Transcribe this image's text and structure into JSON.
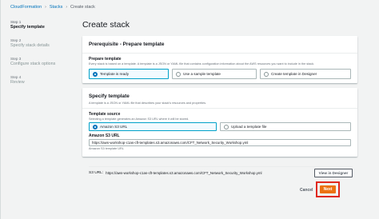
{
  "breadcrumb": {
    "items": [
      "CloudFormation",
      "Stacks",
      "Create stack"
    ]
  },
  "steps": [
    {
      "num": "Step 1",
      "title": "Specify template"
    },
    {
      "num": "Step 2",
      "title": "Specify stack details"
    },
    {
      "num": "Step 3",
      "title": "Configure stack options"
    },
    {
      "num": "Step 4",
      "title": "Review"
    }
  ],
  "page_title": "Create stack",
  "prerequisite": {
    "header": "Prerequisite - Prepare template",
    "label": "Prepare template",
    "description": "Every stack is based on a template. A template is a JSON or YAML file that contains configuration information about the AWS resources you want to include in the stack.",
    "options": [
      "Template is ready",
      "Use a sample template",
      "Create template in Designer"
    ],
    "selected": 0
  },
  "specify": {
    "header": "Specify template",
    "description": "A template is a JSON or YAML file that describes your stack's resources and properties.",
    "source_label": "Template source",
    "source_desc": "Selecting a template generates an Amazon S3 URL where it will be stored.",
    "source_options": [
      "Amazon S3 URL",
      "Upload a template file"
    ],
    "selected": 0,
    "url_label": "Amazon S3 URL",
    "url_value": "https://aws-workshop-c1as-cft-templates.s3.amazonaws.com/CFT_Network_Security_Workshop.yml",
    "url_hint": "Amazon S3 template URL",
    "s3_url_label": "S3 URL:",
    "s3_url_value": "https://aws-workshop-c1as-cft-templates.s3.amazonaws.com/CFT_Network_Security_Workshop.yml",
    "designer_button": "View in Designer"
  },
  "footer": {
    "cancel": "Cancel",
    "next": "Next"
  },
  "colors": {
    "accent": "#0073bb",
    "primary_button": "#ec7211",
    "highlight": "#e0281e"
  }
}
